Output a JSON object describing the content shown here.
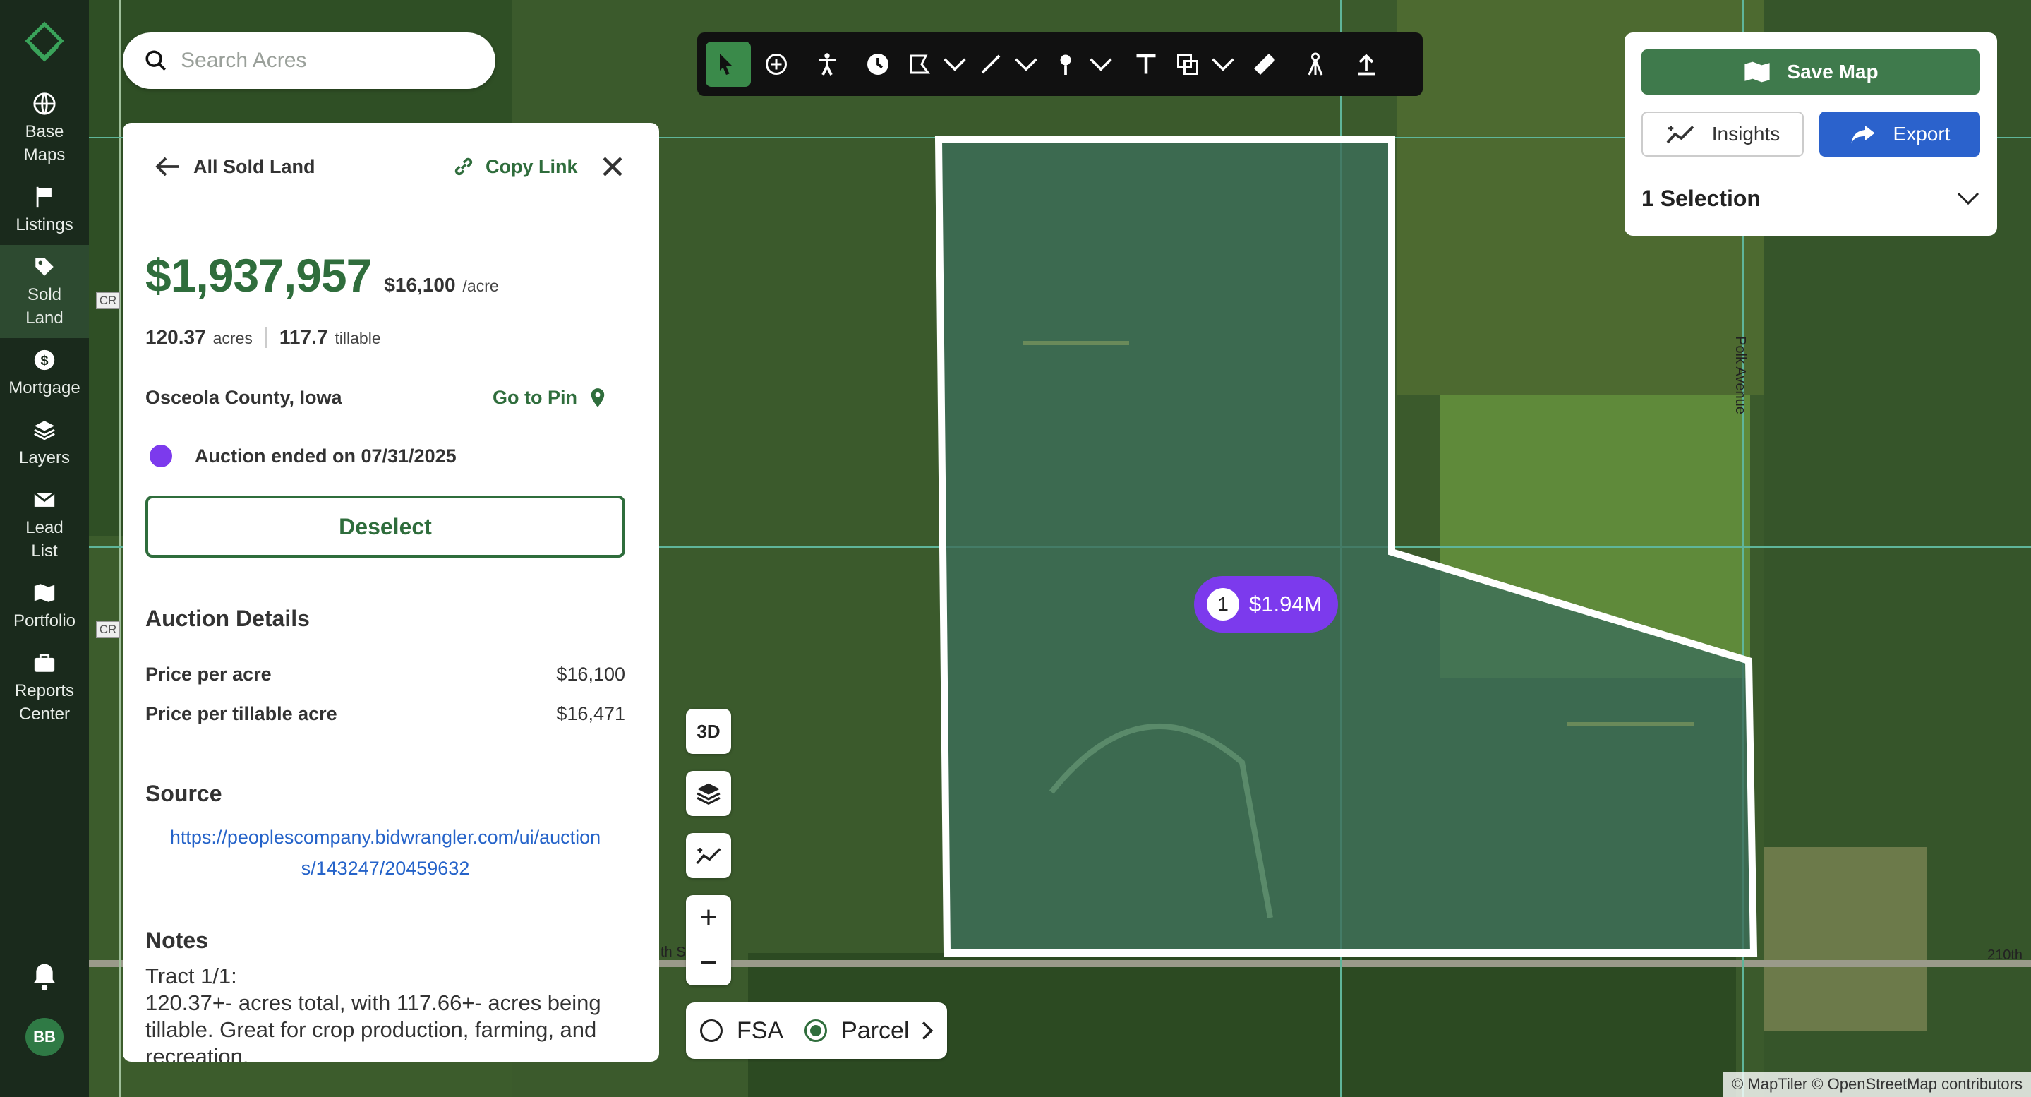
{
  "search": {
    "placeholder": "Search Acres"
  },
  "nav": {
    "items": [
      {
        "label1": "Base",
        "label2": "Maps"
      },
      {
        "label1": "Listings",
        "label2": ""
      },
      {
        "label1": "Sold",
        "label2": "Land"
      },
      {
        "label1": "Mortgage",
        "label2": ""
      },
      {
        "label1": "Layers",
        "label2": ""
      },
      {
        "label1": "Lead",
        "label2": "List"
      },
      {
        "label1": "Portfolio",
        "label2": ""
      },
      {
        "label1": "Reports",
        "label2": "Center"
      }
    ],
    "avatar": "BB"
  },
  "map_labels": {
    "cr": "CR",
    "road_bottom": "210th",
    "road_left": "th S",
    "polk": "Polk Avenue"
  },
  "panel": {
    "back": "All Sold Land",
    "copy_link": "Copy Link",
    "price": "$1,937,957",
    "price_per_acre": "$16,100",
    "per_acre_unit": "/acre",
    "acres": "120.37",
    "acres_unit": "acres",
    "tillable": "117.7",
    "tillable_unit": "tillable",
    "location": "Osceola County, Iowa",
    "go_to_pin": "Go to Pin",
    "auction_status": "Auction ended on 07/31/2025",
    "deselect": "Deselect",
    "auction_details_title": "Auction Details",
    "details": [
      {
        "label": "Price per acre",
        "value": "$16,100"
      },
      {
        "label": "Price per tillable acre",
        "value": "$16,471"
      }
    ],
    "source_title": "Source",
    "source_url_1": "https://peoplescompany.bidwrangler.com/ui/auction",
    "source_url_2": "s/143247/20459632",
    "notes_title": "Notes",
    "notes_1": "Tract 1/1:",
    "notes_2": "120.37+- acres total, with 117.66+- acres being",
    "notes_3": "tillable. Great for crop production, farming, and",
    "notes_4": "recreation."
  },
  "right": {
    "save_map": "Save Map",
    "insights": "Insights",
    "export": "Export",
    "selection": "1 Selection"
  },
  "controls": {
    "threeD": "3D",
    "zoom_in": "+",
    "zoom_out": "−",
    "fsa": "FSA",
    "parcel": "Parcel"
  },
  "marker": {
    "count": "1",
    "value": "$1.94M"
  },
  "attribution": "© MapTiler © OpenStreetMap contributors",
  "colors": {
    "brand": "#2f6d3c",
    "auction": "#7c3aed",
    "export": "#2b62cc"
  }
}
